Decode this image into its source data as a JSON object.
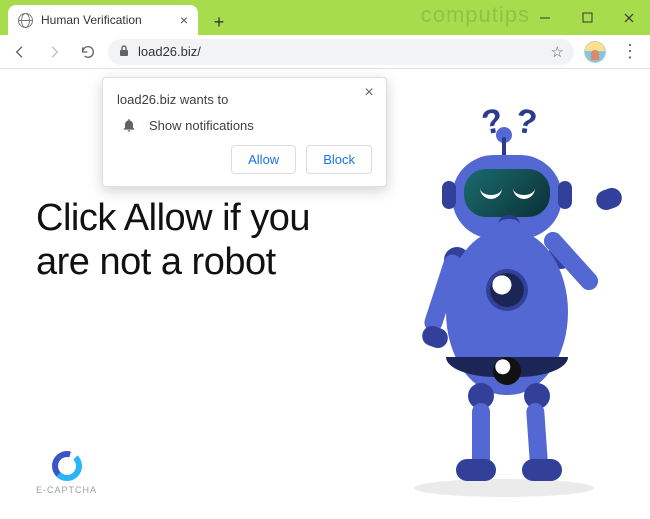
{
  "window": {
    "watermark": "computips"
  },
  "tab": {
    "title": "Human Verification"
  },
  "address_bar": {
    "url": "load26.biz/"
  },
  "notification": {
    "origin_text": "load26.biz wants to",
    "permission_label": "Show notifications",
    "allow_label": "Allow",
    "block_label": "Block"
  },
  "page": {
    "headline": "Click Allow if you are not a robot",
    "captcha_label": "E-CAPTCHA",
    "question_mark": "?"
  }
}
